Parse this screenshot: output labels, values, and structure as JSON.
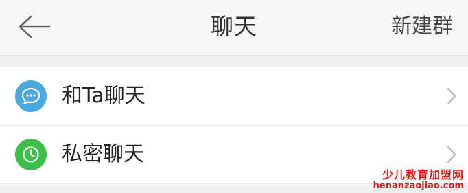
{
  "header": {
    "title": "聊天",
    "action_label": "新建群",
    "back_icon": "arrow-left-icon"
  },
  "list": {
    "items": [
      {
        "label": "和Ta聊天",
        "icon": "chat-bubble-icon",
        "icon_color": "#4aa8e0"
      },
      {
        "label": "私密聊天",
        "icon": "clock-icon",
        "icon_color": "#3ebf4a"
      }
    ]
  },
  "watermark": {
    "site_name": "少儿教育加盟网",
    "url": "henanzaojiao.com",
    "color": "#e01b1b"
  }
}
